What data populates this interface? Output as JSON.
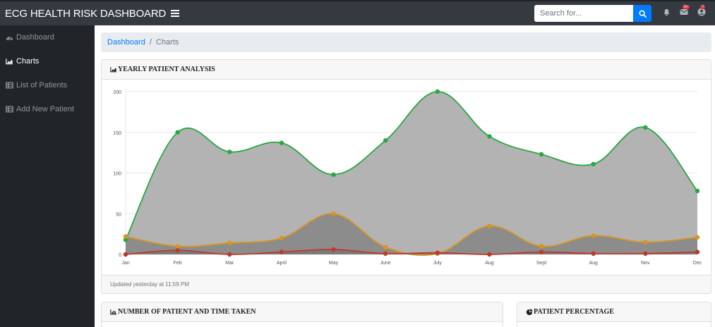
{
  "nav": {
    "brand": "ECG HEALTH RISK DASHBOARD",
    "search_placeholder": "Search for...",
    "alerts_badge": "9+",
    "messages_badge": "7"
  },
  "sidebar": {
    "items": [
      {
        "label": "Dashboard",
        "icon": "tachometer-icon"
      },
      {
        "label": "Charts",
        "icon": "area-chart-icon"
      },
      {
        "label": "List of Patients",
        "icon": "table-icon"
      },
      {
        "label": "Add New Patient",
        "icon": "table-icon"
      }
    ],
    "active_index": 1
  },
  "breadcrumb": {
    "home": "Dashboard",
    "current": "Charts"
  },
  "cards": {
    "yearly_title": "YEARLY PATIENT ANALYSIS",
    "yearly_footer": "Updated yesterday at 11:59 PM",
    "bar_title": "NUMBER OF PATIENT AND TIME TAKEN",
    "pie_title": "PATIENT PERCENTAGE"
  },
  "colors": {
    "navbar": "#343a40",
    "sidebar": "#212529",
    "primary": "#007bff",
    "green": "#28a745",
    "orange": "#e39a1f",
    "red": "#c0392b"
  },
  "chart_data": {
    "type": "area",
    "categories": [
      "Jan",
      "Feb",
      "Mar",
      "April",
      "May",
      "June",
      "July",
      "Aug",
      "Sept",
      "Aug",
      "Nov",
      "Dec"
    ],
    "series": [
      {
        "values": [
          18,
          150,
          126,
          137,
          98,
          140,
          200,
          145,
          123,
          111,
          156,
          78
        ],
        "color": "#28a745",
        "fill": "#b3b3b3"
      },
      {
        "values": [
          22,
          10,
          14,
          20,
          50,
          9,
          1,
          35,
          10,
          23,
          15,
          21
        ],
        "color": "#d9951e",
        "fill": "#8c8c8c"
      },
      {
        "values": [
          0,
          5,
          0,
          3,
          6,
          1,
          2,
          0,
          3,
          1,
          1,
          3
        ],
        "color": "#c0392b",
        "fill": "#7a7a7a"
      }
    ],
    "ylim": [
      0,
      200
    ],
    "yticks": [
      0,
      50,
      100,
      150,
      200
    ],
    "grid": true
  }
}
